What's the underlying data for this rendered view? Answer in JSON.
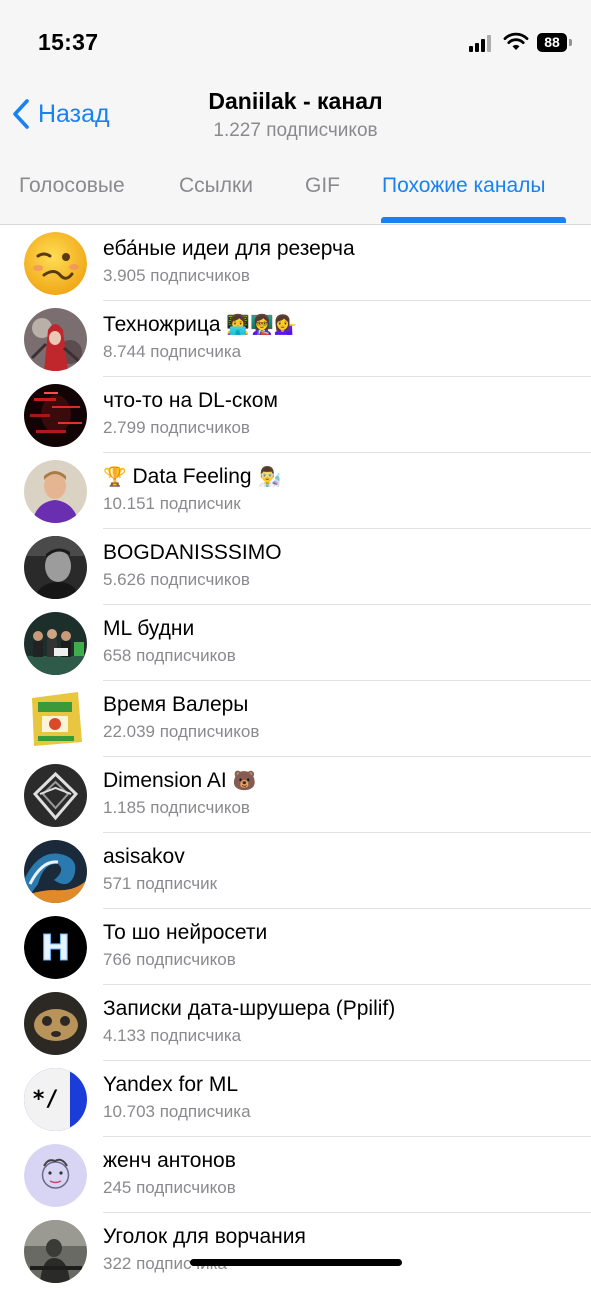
{
  "status_bar": {
    "time": "15:37",
    "battery": "88"
  },
  "nav": {
    "back_label": "Назад",
    "title": "Daniilak - канал",
    "subtitle": "1.227 подписчиков"
  },
  "tabs": [
    {
      "label": "Голосовые"
    },
    {
      "label": "Ссылки"
    },
    {
      "label": "GIF"
    },
    {
      "label": "Похожие каналы"
    }
  ],
  "colors": {
    "accent": "#1a82f0",
    "secondary_text": "#8a8a8e"
  },
  "channels": [
    {
      "name": "еба́ные идеи для резерча",
      "subs": "3.905 подписчиков",
      "avatar": "woozy-face-emoji"
    },
    {
      "name": "Техножрица",
      "emoji": "👩‍💻👩‍🏫💁‍♀️",
      "subs": "8.744 подписчика",
      "avatar": "red-hooded-figure-photo"
    },
    {
      "name": "что-то на DL-ском",
      "subs": "2.799 подписчиков",
      "avatar": "red-glitch-portrait-photo"
    },
    {
      "name": "Data Feeling",
      "prefix_emoji": "🏆",
      "emoji": "👨‍🔬",
      "subs": "10.151 подписчик",
      "avatar": "man-in-purple-hoodie-photo"
    },
    {
      "name": "BOGDANISSSIMO",
      "subs": "5.626 подписчиков",
      "avatar": "bw-man-portrait-photo"
    },
    {
      "name": "ML будни",
      "subs": "658 подписчиков",
      "avatar": "group-photo"
    },
    {
      "name": "Время Валеры",
      "subs": "22.039 подписчиков",
      "avatar": "game-box-photo"
    },
    {
      "name": "Dimension AI",
      "emoji": "🐻",
      "subs": "1.185 подписчиков",
      "avatar": "geometric-logo"
    },
    {
      "name": "asisakov",
      "subs": "571 подписчик",
      "avatar": "wave-painting"
    },
    {
      "name": "То шо нейросети",
      "subs": "766 подписчиков",
      "avatar": "letter-h-logo"
    },
    {
      "name": "Записки дата-шрушера (Ppilif)",
      "subs": "4.133 подписчика",
      "avatar": "bread-face-photo"
    },
    {
      "name": "Yandex for ML",
      "subs": "10.703 подписчика",
      "avatar": "comment-slash-logo"
    },
    {
      "name": "женч антонов",
      "subs": "245 подписчиков",
      "avatar": "cartoon-face-drawing"
    },
    {
      "name": "Уголок для ворчания",
      "subs": "322 подписчика",
      "avatar": "man-at-desk-photo"
    }
  ]
}
